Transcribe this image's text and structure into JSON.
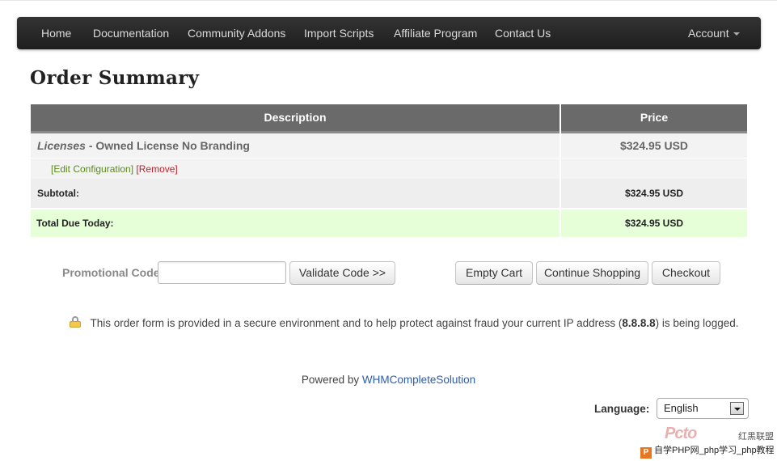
{
  "nav": {
    "items": [
      {
        "label": "Home"
      },
      {
        "label": "Documentation"
      },
      {
        "label": "Community Addons"
      },
      {
        "label": "Import Scripts"
      },
      {
        "label": "Affiliate Program"
      },
      {
        "label": "Contact Us"
      }
    ],
    "account_label": "Account"
  },
  "page": {
    "title": "Order Summary"
  },
  "table": {
    "headers": {
      "description": "Description",
      "price": "Price"
    },
    "item": {
      "group": "Licenses",
      "separator": " - ",
      "name": "Owned License No Branding",
      "price": "$324.95 USD",
      "edit_label": "[Edit Configuration]",
      "remove_label": "[Remove]"
    },
    "subtotal": {
      "label": "Subtotal:",
      "value": "$324.95 USD"
    },
    "total": {
      "label": "Total Due Today:",
      "value": "$324.95 USD"
    }
  },
  "promo": {
    "label": "Promotional Code",
    "input_value": "",
    "validate_label": "Validate Code >>"
  },
  "buttons": {
    "empty_cart": "Empty Cart",
    "continue_shopping": "Continue Shopping",
    "checkout": "Checkout"
  },
  "secure": {
    "text_before": "This order form is provided in a secure environment and to help protect against fraud your current IP address (",
    "ip": "8.8.8.8",
    "text_after": ") is being logged."
  },
  "footer": {
    "powered_text": "Powered by ",
    "powered_link": "WHMCompleteSolution"
  },
  "language": {
    "label": "Language:",
    "selected": "English"
  },
  "watermark": {
    "logo_text": "Pcto",
    "logo_sub": "红黑联盟",
    "icon_letter": "P",
    "bar_text": "自学PHP网_php学习_php教程"
  },
  "colors": {
    "navbar": "#2a2a2a",
    "table_header": "#6a6a6a",
    "total_row": "#e6ffd9",
    "link_green": "#5a8a1a",
    "link_red": "#c0222a",
    "link_blue": "#2a5db0"
  }
}
